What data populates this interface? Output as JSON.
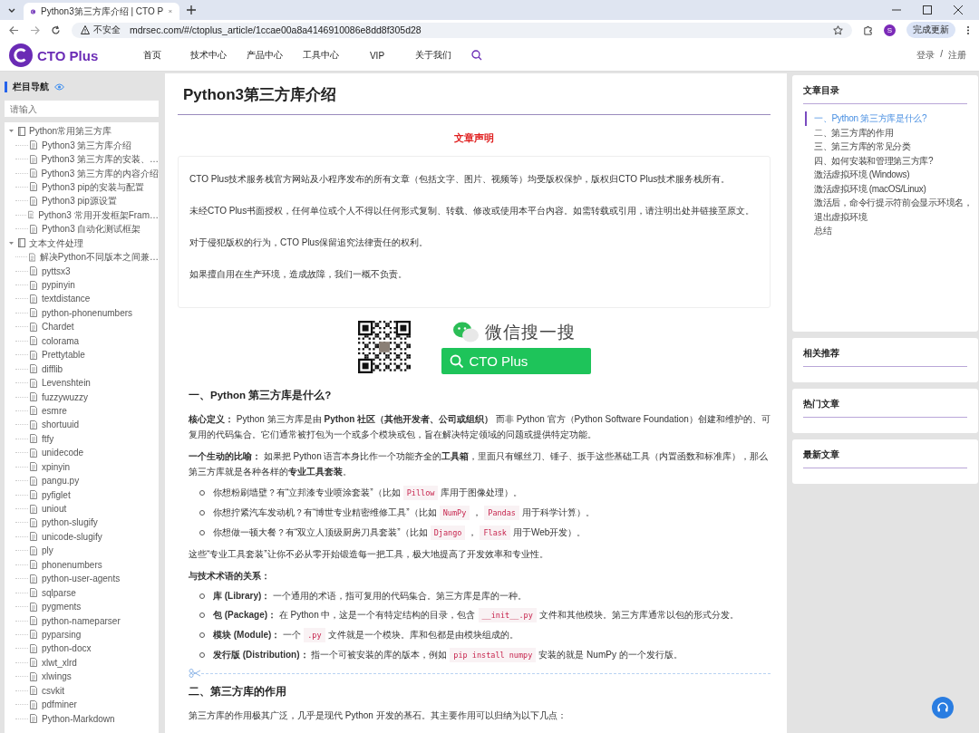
{
  "browser": {
    "tab_title": "Python3第三方库介绍 | CTO P",
    "url": "mdrsec.com/#/ctoplus_article/1ccae00a8a4146910086e8dd8f305d28",
    "security_label": "不安全",
    "profile_initial": "S",
    "update_button": "完成更新"
  },
  "header": {
    "logo": "CTO Plus",
    "nav": [
      "首页",
      "技术中心",
      "产品中心",
      "工具中心",
      "VIP",
      "关于我们"
    ],
    "login": "登录",
    "separator": "/",
    "register": "注册"
  },
  "sidebar": {
    "title": "栏目导航",
    "search": {
      "placeholder": "请输入"
    },
    "tree": [
      {
        "label": "Python常用第三方库",
        "expanded": true,
        "children": [
          {
            "label": "Python3 第三方库介绍"
          },
          {
            "label": "Python3 第三方库的安装、…"
          },
          {
            "label": "Python3 第三方库的内容介绍"
          },
          {
            "label": "Python3 pip的安装与配置"
          },
          {
            "label": "Python3 pip源设置"
          },
          {
            "label": "Python3 常用开发框架Fram…"
          },
          {
            "label": "Python3 自动化测试框架"
          }
        ]
      },
      {
        "label": "文本文件处理",
        "expanded": true,
        "children": [
          {
            "label": "解决Python不同版本之间兼…"
          },
          {
            "label": "pyttsx3"
          },
          {
            "label": "pypinyin"
          },
          {
            "label": "textdistance"
          },
          {
            "label": "python-phonenumbers"
          },
          {
            "label": "Chardet"
          },
          {
            "label": "colorama"
          },
          {
            "label": "Prettytable"
          },
          {
            "label": "difflib"
          },
          {
            "label": "Levenshtein"
          },
          {
            "label": "fuzzywuzzy"
          },
          {
            "label": "esmre"
          },
          {
            "label": "shortuuid"
          },
          {
            "label": "ftfy"
          },
          {
            "label": "unidecode"
          },
          {
            "label": "xpinyin"
          },
          {
            "label": "pangu.py"
          },
          {
            "label": "pyfiglet"
          },
          {
            "label": "uniout"
          },
          {
            "label": "python-slugify"
          },
          {
            "label": "unicode-slugify"
          },
          {
            "label": "ply"
          },
          {
            "label": "phonenumbers"
          },
          {
            "label": "python-user-agents"
          },
          {
            "label": "sqlparse"
          },
          {
            "label": "pygments"
          },
          {
            "label": "python-nameparser"
          },
          {
            "label": "pyparsing"
          },
          {
            "label": "python-docx"
          },
          {
            "label": "xlwt_xlrd"
          },
          {
            "label": "xlwings"
          },
          {
            "label": "csvkit"
          },
          {
            "label": "pdfminer"
          },
          {
            "label": "Python-Markdown"
          }
        ]
      }
    ]
  },
  "article": {
    "title": "Python3第三方库介绍",
    "notice_title": "文章声明",
    "notice": [
      "CTO Plus技术服务栈官方网站及小程序发布的所有文章（包括文字、图片、视频等）均受版权保护，版权归CTO Plus技术服务栈所有。",
      "未经CTO Plus书面授权，任何单位或个人不得以任何形式复制、转载、修改或使用本平台内容。如需转载或引用，请注明出处并链接至原文。",
      "对于侵犯版权的行为，CTO Plus保留追究法律责任的权利。",
      "如果擅自用在生产环境，造成故障，我们一概不负责。"
    ],
    "wechat": {
      "search_label": "微信搜一搜",
      "search_button": "CTO Plus"
    },
    "blocks": [
      {
        "kind": "heading",
        "text": "一、Python 第三方库是什么?"
      },
      {
        "kind": "paragraph",
        "text": "**核心定义：** Python 第三方库是由 **Python 社区（其他开发者、公司或组织）** 而非 Python 官方（Python Software Foundation）创建和维护的、可复用的代码集合。它们通常被打包为一个或多个模块或包，旨在解决特定领域的问题或提供特定功能。"
      },
      {
        "kind": "paragraph",
        "text": "**一个生动的比喻：** 如果把 Python 语言本身比作一个功能齐全的**工具箱**，里面只有螺丝刀、锤子、扳手这些基础工具（内置函数和标准库），那么第三方库就是各种各样的**专业工具套装**。"
      },
      {
        "kind": "list",
        "items": [
          [
            {
              "kind": "text",
              "text": "你想粉刷墙壁？有“立邦漆专业喷涂套装”（比如 "
            },
            {
              "kind": "code",
              "text": "Pillow"
            },
            {
              "kind": "text",
              "text": " 库用于图像处理）。"
            }
          ],
          [
            {
              "kind": "text",
              "text": "你想拧紧汽车发动机？有“博世专业精密维修工具”（比如 "
            },
            {
              "kind": "code",
              "text": "NumPy"
            },
            {
              "kind": "text",
              "text": "，"
            },
            {
              "kind": "code",
              "text": "Pandas"
            },
            {
              "kind": "text",
              "text": " 用于科学计算）。"
            }
          ],
          [
            {
              "kind": "text",
              "text": "你想做一顿大餐？有“双立人顶级厨房刀具套装”（比如 "
            },
            {
              "kind": "code",
              "text": "Django"
            },
            {
              "kind": "text",
              "text": "，"
            },
            {
              "kind": "code",
              "text": "Flask"
            },
            {
              "kind": "text",
              "text": " 用于Web开发）。"
            }
          ]
        ]
      },
      {
        "kind": "paragraph",
        "text": "这些“专业工具套装”让你不必从零开始锻造每一把工具，极大地提高了开发效率和专业性。"
      },
      {
        "kind": "label",
        "text": "与技术术语的关系："
      },
      {
        "kind": "list",
        "items": [
          [
            {
              "kind": "text",
              "text": "**库 (Library)：** 一个通用的术语，指可复用的代码集合。第三方库是库的一种。"
            }
          ],
          [
            {
              "kind": "text",
              "text": "**包 (Package)：** 在 Python 中，这是一个有特定结构的目录，包含 "
            },
            {
              "kind": "code",
              "text": "__init__.py"
            },
            {
              "kind": "text",
              "text": " 文件和其他模块。第三方库通常以包的形式分发。"
            }
          ],
          [
            {
              "kind": "text",
              "text": "**模块 (Module)：** 一个 "
            },
            {
              "kind": "code",
              "text": ".py"
            },
            {
              "kind": "text",
              "text": " 文件就是一个模块。库和包都是由模块组成的。"
            }
          ],
          [
            {
              "kind": "text",
              "text": "**发行版 (Distribution)：** 指一个可被安装的库的版本，例如 "
            },
            {
              "kind": "code",
              "text": "pip install numpy"
            },
            {
              "kind": "text",
              "text": " 安装的就是 NumPy 的一个发行版。"
            }
          ]
        ]
      },
      {
        "kind": "divider"
      },
      {
        "kind": "heading",
        "text": "二、第三方库的作用"
      },
      {
        "kind": "paragraph",
        "text": "第三方库的作用极其广泛，几乎是现代 Python 开发的基石。其主要作用可以归纳为以下几点："
      }
    ]
  },
  "toc": {
    "title": "文章目录",
    "items": [
      {
        "label": "一、Python 第三方库是什么?",
        "selected": true
      },
      {
        "label": "二、第三方库的作用",
        "selected": false
      },
      {
        "label": "三、第三方库的常见分类",
        "selected": false
      },
      {
        "label": "四、如何安装和管理第三方库?",
        "selected": false
      },
      {
        "label": "激活虚拟环境 (Windows)",
        "selected": false
      },
      {
        "label": "激活虚拟环境 (macOS/Linux)",
        "selected": false
      },
      {
        "label": "激活后，命令行提示符前会显示环境名，",
        "selected": false
      },
      {
        "label": "退出虚拟环境",
        "selected": false
      },
      {
        "label": "总结",
        "selected": false
      }
    ]
  },
  "side_cards": [
    "相关推荐",
    "热门文章",
    "最新文章"
  ]
}
